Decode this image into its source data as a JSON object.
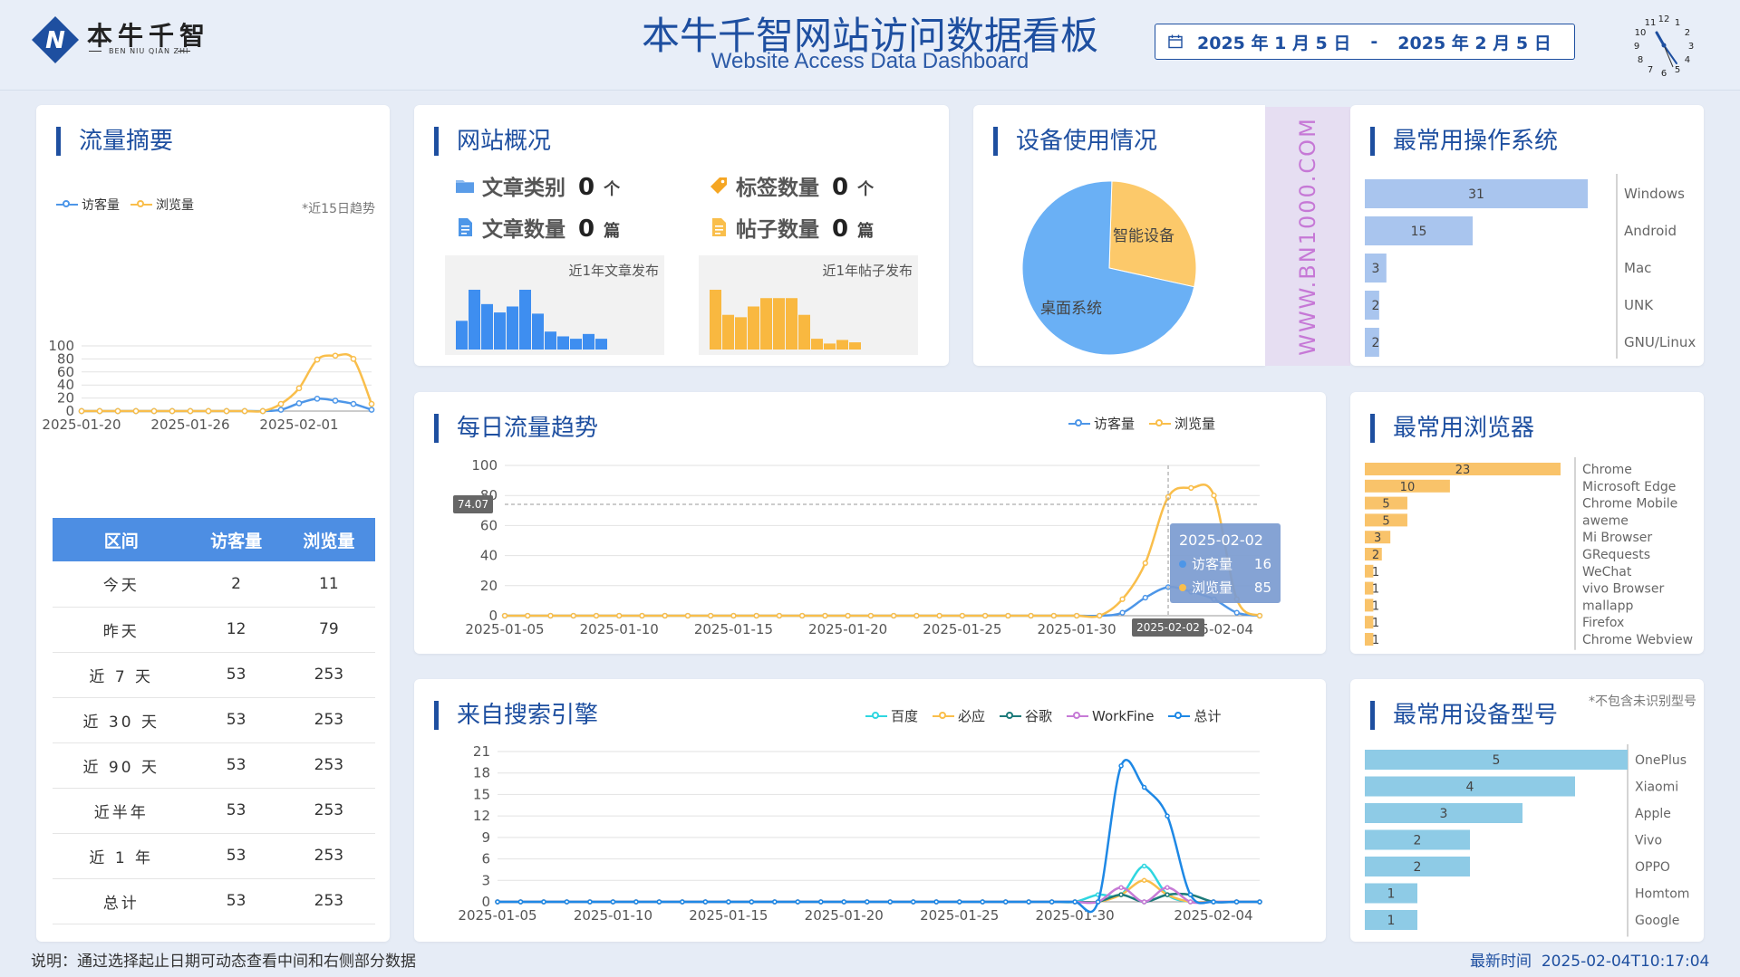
{
  "header": {
    "logo_cn": "本牛千智",
    "logo_en": "BEN NIU QIAN ZHI",
    "title": "本牛千智网站访问数据看板",
    "subtitle": "Website Access Data Dashboard",
    "date_start": "2025 年 1 月 5 日",
    "date_sep": "-",
    "date_end": "2025 年 2 月 5 日",
    "calendar_icon": "calendar-icon",
    "clock_numbers": [
      "12",
      "1",
      "2",
      "3",
      "4",
      "5",
      "6",
      "7",
      "8",
      "9",
      "10",
      "11"
    ]
  },
  "colors": {
    "accent": "#1e4fa0",
    "visitor": "#4d96e8",
    "pageview": "#f9be4b",
    "table_header": "#4d8ee3",
    "os_bar": "#a9c5ee",
    "browser_bar": "#f9c36a",
    "device_bar": "#8ecbe6"
  },
  "summary": {
    "title": "流量摘要",
    "legend_visitor": "访客量",
    "legend_pageview": "浏览量",
    "note": "*近15日趋势",
    "table_headers": [
      "区间",
      "访客量",
      "浏览量"
    ],
    "rows": [
      [
        "今天",
        "2",
        "11"
      ],
      [
        "昨天",
        "12",
        "79"
      ],
      [
        "近 7 天",
        "53",
        "253"
      ],
      [
        "近 30 天",
        "53",
        "253"
      ],
      [
        "近 90 天",
        "53",
        "253"
      ],
      [
        "近半年",
        "53",
        "253"
      ],
      [
        "近 1 年",
        "53",
        "253"
      ],
      [
        "总计",
        "53",
        "253"
      ]
    ]
  },
  "overview": {
    "title": "网站概况",
    "stats": [
      {
        "label": "文章类别",
        "value": "0",
        "unit": "个",
        "icon": "folder-icon"
      },
      {
        "label": "标签数量",
        "value": "0",
        "unit": "个",
        "icon": "tag-icon"
      },
      {
        "label": "文章数量",
        "value": "0",
        "unit": "篇",
        "icon": "document-icon"
      },
      {
        "label": "帖子数量",
        "value": "0",
        "unit": "篇",
        "icon": "post-icon"
      }
    ],
    "article_chart_label": "近1年文章发布",
    "post_chart_label": "近1年帖子发布"
  },
  "devices": {
    "title": "设备使用情况",
    "watermark": "WWW.BN1000.COM"
  },
  "os": {
    "title": "最常用操作系统"
  },
  "daily": {
    "title": "每日流量趋势",
    "legend_visitor": "访客量",
    "legend_pageview": "浏览量",
    "tooltip": {
      "date": "2025-02-02",
      "visitor_label": "访客量",
      "visitor_value": "16",
      "pageview_label": "浏览量",
      "pageview_value": "85"
    },
    "crosshair_y": "74.07",
    "crosshair_x": "2025-02-02"
  },
  "browsers": {
    "title": "最常用浏览器"
  },
  "search": {
    "title": "来自搜索引擎",
    "legend": [
      "百度",
      "必应",
      "谷歌",
      "WorkFine",
      "总计"
    ]
  },
  "device_models": {
    "title": "最常用设备型号",
    "note": "*不包含未识别型号"
  },
  "footer": {
    "note": "说明：通过选择起止日期可动态查看中间和右侧部分数据",
    "time_label": "最新时间",
    "time_value": "2025-02-04T10:17:04"
  },
  "chart_data": [
    {
      "id": "summary-trend",
      "type": "line",
      "x_ticks": [
        "2025-01-20",
        "2025-01-26",
        "2025-02-01"
      ],
      "ylim": [
        0,
        100
      ],
      "y_ticks": [
        0,
        20,
        40,
        60,
        80,
        100
      ],
      "series": [
        {
          "name": "访客量",
          "values": [
            0,
            0,
            0,
            0,
            0,
            0,
            0,
            0,
            0,
            0,
            0,
            2,
            12,
            19,
            16,
            11,
            2
          ]
        },
        {
          "name": "浏览量",
          "values": [
            0,
            0,
            0,
            0,
            0,
            0,
            0,
            0,
            0,
            0,
            0,
            11,
            35,
            79,
            85,
            80,
            11
          ]
        }
      ]
    },
    {
      "id": "article-publish",
      "type": "bar",
      "values": [
        48,
        100,
        76,
        62,
        72,
        100,
        60,
        30,
        22,
        18,
        26,
        18
      ]
    },
    {
      "id": "post-publish",
      "type": "bar",
      "values": [
        100,
        58,
        54,
        72,
        86,
        86,
        86,
        58,
        18,
        10,
        16,
        12
      ]
    },
    {
      "id": "device-pie",
      "type": "pie",
      "slices": [
        {
          "name": "智能设备",
          "value": 28
        },
        {
          "name": "桌面系统",
          "value": 72
        }
      ]
    },
    {
      "id": "os-bar",
      "type": "bar",
      "categories": [
        "Windows",
        "Android",
        "Mac",
        "UNK",
        "GNU/Linux"
      ],
      "values": [
        31,
        15,
        3,
        2,
        2
      ]
    },
    {
      "id": "daily-trend",
      "type": "line",
      "x_ticks": [
        "2025-01-05",
        "2025-01-10",
        "2025-01-15",
        "2025-01-20",
        "2025-01-25",
        "2025-01-30",
        "2025-02-04"
      ],
      "ylim": [
        0,
        100
      ],
      "y_ticks": [
        0,
        20,
        40,
        60,
        80,
        100
      ],
      "series": [
        {
          "name": "访客量",
          "values": [
            0,
            0,
            0,
            0,
            0,
            0,
            0,
            0,
            0,
            0,
            0,
            0,
            0,
            0,
            0,
            0,
            0,
            0,
            0,
            0,
            0,
            0,
            0,
            0,
            0,
            0,
            0,
            2,
            12,
            19,
            16,
            11,
            2,
            0
          ]
        },
        {
          "name": "浏览量",
          "values": [
            0,
            0,
            0,
            0,
            0,
            0,
            0,
            0,
            0,
            0,
            0,
            0,
            0,
            0,
            0,
            0,
            0,
            0,
            0,
            0,
            0,
            0,
            0,
            0,
            0,
            0,
            0,
            11,
            35,
            79,
            85,
            80,
            11,
            0
          ]
        }
      ]
    },
    {
      "id": "browser-bar",
      "type": "bar",
      "categories": [
        "Chrome",
        "Microsoft Edge",
        "Chrome Mobile",
        "aweme",
        "Mi Browser",
        "GRequests",
        "WeChat",
        "vivo Browser",
        "mallapp",
        "Firefox",
        "Chrome Webview"
      ],
      "values": [
        23,
        10,
        5,
        5,
        3,
        2,
        1,
        1,
        1,
        1,
        1
      ]
    },
    {
      "id": "search-trend",
      "type": "line",
      "x_ticks": [
        "2025-01-05",
        "2025-01-10",
        "2025-01-15",
        "2025-01-20",
        "2025-01-25",
        "2025-01-30",
        "2025-02-04"
      ],
      "ylim": [
        0,
        21
      ],
      "y_ticks": [
        0,
        3,
        6,
        9,
        12,
        15,
        18,
        21
      ],
      "series": [
        {
          "name": "百度",
          "values": [
            0,
            0,
            0,
            0,
            0,
            0,
            0,
            0,
            0,
            0,
            0,
            0,
            0,
            0,
            0,
            0,
            0,
            0,
            0,
            0,
            0,
            0,
            0,
            0,
            0,
            0,
            1,
            1,
            5,
            1,
            0,
            0,
            0,
            0
          ]
        },
        {
          "name": "必应",
          "values": [
            0,
            0,
            0,
            0,
            0,
            0,
            0,
            0,
            0,
            0,
            0,
            0,
            0,
            0,
            0,
            0,
            0,
            0,
            0,
            0,
            0,
            0,
            0,
            0,
            0,
            0,
            0,
            1,
            3,
            1,
            0,
            0,
            0,
            0
          ]
        },
        {
          "name": "谷歌",
          "values": [
            0,
            0,
            0,
            0,
            0,
            0,
            0,
            0,
            0,
            0,
            0,
            0,
            0,
            0,
            0,
            0,
            0,
            0,
            0,
            0,
            0,
            0,
            0,
            0,
            0,
            0,
            0,
            1,
            0,
            1,
            1,
            0,
            0,
            0
          ]
        },
        {
          "name": "WorkFine",
          "values": [
            0,
            0,
            0,
            0,
            0,
            0,
            0,
            0,
            0,
            0,
            0,
            0,
            0,
            0,
            0,
            0,
            0,
            0,
            0,
            0,
            0,
            0,
            0,
            0,
            0,
            0,
            0,
            2,
            0,
            2,
            0,
            0,
            0,
            0
          ]
        },
        {
          "name": "总计",
          "values": [
            0,
            0,
            0,
            0,
            0,
            0,
            0,
            0,
            0,
            0,
            0,
            0,
            0,
            0,
            0,
            0,
            0,
            0,
            0,
            0,
            0,
            0,
            0,
            0,
            0,
            0,
            0,
            19,
            16,
            12,
            1,
            0,
            0,
            0
          ]
        }
      ]
    },
    {
      "id": "device-model-bar",
      "type": "bar",
      "categories": [
        "OnePlus",
        "Xiaomi",
        "Apple",
        "Vivo",
        "OPPO",
        "Homtom",
        "Google"
      ],
      "values": [
        5,
        4,
        3,
        2,
        2,
        1,
        1
      ]
    }
  ]
}
